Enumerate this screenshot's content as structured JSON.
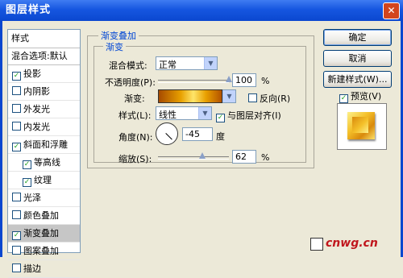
{
  "window": {
    "title": "图层样式",
    "close_glyph": "✕"
  },
  "style_list": {
    "header": "样式",
    "blend_item": "混合选项:默认",
    "items": [
      {
        "label": "投影",
        "checked": true,
        "sub": false,
        "selected": false
      },
      {
        "label": "内阴影",
        "checked": false,
        "sub": false,
        "selected": false
      },
      {
        "label": "外发光",
        "checked": false,
        "sub": false,
        "selected": false
      },
      {
        "label": "内发光",
        "checked": false,
        "sub": false,
        "selected": false
      },
      {
        "label": "斜面和浮雕",
        "checked": true,
        "sub": false,
        "selected": false
      },
      {
        "label": "等高线",
        "checked": true,
        "sub": true,
        "selected": false
      },
      {
        "label": "纹理",
        "checked": true,
        "sub": true,
        "selected": false
      },
      {
        "label": "光泽",
        "checked": false,
        "sub": false,
        "selected": false
      },
      {
        "label": "颜色叠加",
        "checked": false,
        "sub": false,
        "selected": false
      },
      {
        "label": "渐变叠加",
        "checked": true,
        "sub": false,
        "selected": true
      },
      {
        "label": "图案叠加",
        "checked": false,
        "sub": false,
        "selected": false
      },
      {
        "label": "描边",
        "checked": false,
        "sub": false,
        "selected": false
      }
    ]
  },
  "panel": {
    "outer_title": "渐变叠加",
    "inner_title": "渐变",
    "blend_mode_label": "混合模式:",
    "blend_mode_value": "正常",
    "opacity_label": "不透明度(P):",
    "opacity_value": "100",
    "opacity_unit": "%",
    "opacity_level": 1.0,
    "gradient_label": "渐变:",
    "reverse_label": "反向(R)",
    "reverse_checked": false,
    "style_label": "样式(L):",
    "style_value": "线性",
    "align_label": "与图层对齐(I)",
    "align_checked": true,
    "angle_label": "角度(N):",
    "angle_value": "-45",
    "angle_unit": "度",
    "scale_label": "缩放(S):",
    "scale_value": "62",
    "scale_unit": "%",
    "scale_level": 0.62
  },
  "buttons": {
    "ok": "确定",
    "cancel": "取消",
    "new_style": "新建样式(W)...",
    "preview_label": "预览(V)",
    "preview_checked": true
  },
  "watermark": "cnwg.cn",
  "colors": {
    "title_bar": "#1656e0",
    "group_title": "#0046d5",
    "check": "#21a121"
  }
}
